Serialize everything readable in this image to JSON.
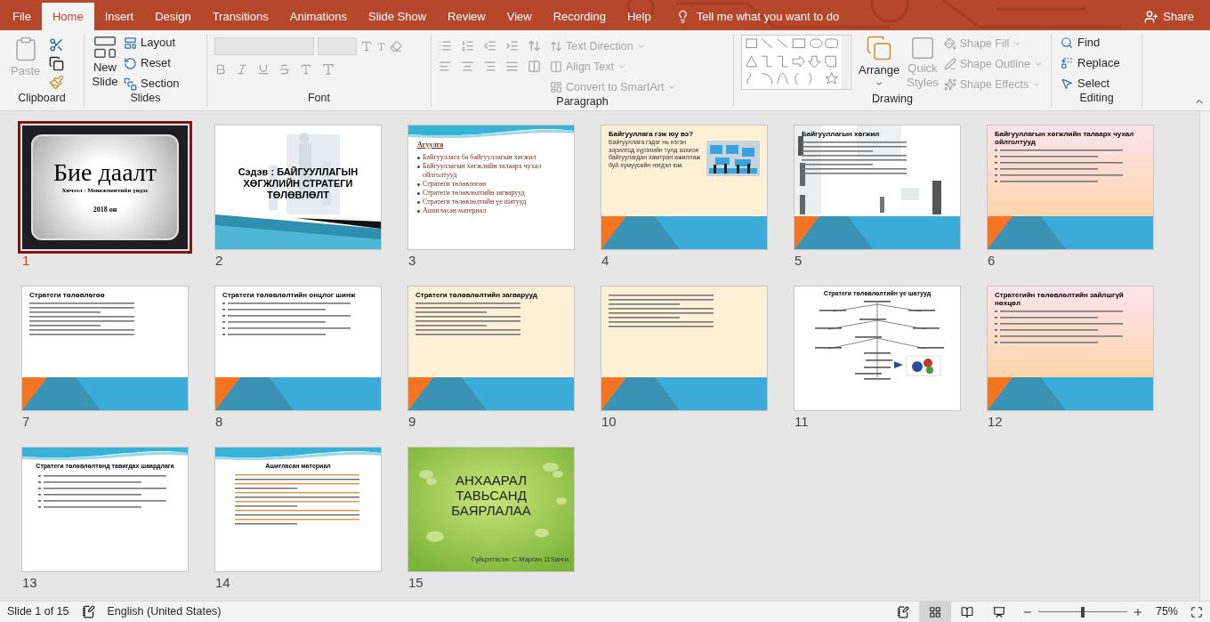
{
  "tabs": [
    {
      "label": "File",
      "selected": false
    },
    {
      "label": "Home",
      "selected": true
    },
    {
      "label": "Insert",
      "selected": false
    },
    {
      "label": "Design",
      "selected": false
    },
    {
      "label": "Transitions",
      "selected": false
    },
    {
      "label": "Animations",
      "selected": false
    },
    {
      "label": "Slide Show",
      "selected": false
    },
    {
      "label": "Review",
      "selected": false
    },
    {
      "label": "View",
      "selected": false
    },
    {
      "label": "Recording",
      "selected": false
    },
    {
      "label": "Help",
      "selected": false
    }
  ],
  "tell_me": "Tell me what you want to do",
  "share": "Share",
  "clipboard": {
    "label": "Clipboard",
    "paste": "Paste",
    "paste_disabled": true
  },
  "slides_group": {
    "label": "Slides",
    "new_slide": [
      "New",
      "Slide"
    ],
    "commands": [
      "Layout",
      "Reset",
      "Section"
    ]
  },
  "font": {
    "label": "Font"
  },
  "paragraph": {
    "label": "Paragraph",
    "commands": [
      {
        "label": "Text Direction",
        "disabled": true
      },
      {
        "label": "Align Text",
        "disabled": true
      },
      {
        "label": "Convert to SmartArt",
        "disabled": true
      }
    ]
  },
  "drawing": {
    "label": "Drawing",
    "arrange": "Arrange",
    "quick_styles": [
      "Quick",
      "Styles"
    ],
    "commands": [
      {
        "label": "Shape Fill",
        "disabled": true
      },
      {
        "label": "Shape Outline",
        "disabled": true
      },
      {
        "label": "Shape Effects",
        "disabled": true
      }
    ]
  },
  "editing": {
    "label": "Editing",
    "commands": [
      "Find",
      "Replace",
      "Select"
    ]
  },
  "slides": [
    {
      "number": "1",
      "selected": true,
      "kind": "ornate",
      "title": "Бие даалт",
      "subtitle": "Хичээл : Менежментийн үндэс",
      "footer": "2018 он"
    },
    {
      "number": "2",
      "selected": false,
      "title": "Сэдэв :  БАЙГУУЛЛАГЫН ХӨГЖЛИЙН СТРАТЕГИ ТӨЛӨВЛӨЛТ"
    },
    {
      "number": "3",
      "selected": false,
      "kind": "wave",
      "title": "Агуулга",
      "bullets": [
        "Байгууллага ба байгууллагын хөгжил",
        "Байгууллагын хөгжлийн талаарх чухал ойлголтууд",
        "Стратеги төлөвлөгөө",
        "Стратеги төлөвлөлтийн загварууд",
        "Стратеги төлөвлөлтийн үе шатууд",
        "Ашигласан материал"
      ]
    },
    {
      "number": "4",
      "selected": false,
      "kind": "cream",
      "title": "Байгууллага гэж юу вэ?",
      "body": "Байгууллага гэдэг нь нэгэн зорилгод хүрэхийн тулд зохион байгуулагдан хамтран ажиллаж буй хүмүүсийн нэгдэл юм."
    },
    {
      "number": "5",
      "selected": false,
      "kind": "white",
      "title": "Байгууллагын хөгжил",
      "parts": [
        {
          "kind": "paragraph"
        },
        {
          "kind": "backdrop"
        }
      ]
    },
    {
      "number": "6",
      "selected": false,
      "kind": "peach",
      "title": "Байгууллагын хөгжлийн талаарх чухал ойлголтууд",
      "parts": [
        {
          "kind": "list"
        }
      ]
    },
    {
      "number": "7",
      "selected": false,
      "kind": "white",
      "title": "Стратеги төлөвлөгөө",
      "parts": [
        {
          "kind": "paragraph"
        }
      ]
    },
    {
      "number": "8",
      "selected": false,
      "kind": "white",
      "title": "Стратеги төлөвлөлтийн онцлог шинж",
      "parts": [
        {
          "kind": "list"
        }
      ]
    },
    {
      "number": "9",
      "selected": false,
      "kind": "cream",
      "title": "Стратеги төлөвлөлтийн загварууд",
      "parts": [
        {
          "kind": "paragraph"
        }
      ]
    },
    {
      "number": "10",
      "selected": false,
      "kind": "cream",
      "parts": [
        {
          "kind": "paragraph"
        }
      ]
    },
    {
      "number": "11",
      "selected": false,
      "kind": "plain",
      "title": "Стратеги төлөвлөлтийн үе шатууд",
      "parts": [
        {
          "kind": "diagram"
        }
      ]
    },
    {
      "number": "12",
      "selected": false,
      "kind": "peach",
      "title": "Стратегийн төлөвлөлтийн зайлшгүй нөхцөл",
      "parts": [
        {
          "kind": "list"
        }
      ]
    },
    {
      "number": "13",
      "selected": false,
      "kind": "wave",
      "title": "Стратеги төлөвлөлтөнд тавигдах шаардлага",
      "parts": [
        {
          "kind": "list"
        }
      ]
    },
    {
      "number": "14",
      "selected": false,
      "kind": "wave",
      "title": "Ашигласан материал",
      "parts": [
        {
          "kind": "links"
        }
      ]
    },
    {
      "number": "15",
      "selected": false,
      "kind": "green",
      "title": "АНХААРАЛ ТАВЬСАНД БАЯРЛАЛАА",
      "footer": "Гүйцэтгэсэн: С.Марган  11Sанги"
    }
  ],
  "status": {
    "slide": "Slide 1 of 15",
    "language": "English (United States)",
    "zoom": "75%",
    "level": 0.5
  },
  "views": [
    {
      "kind": "normal",
      "selected": false
    },
    {
      "kind": "sorter",
      "selected": true
    },
    {
      "kind": "reading",
      "selected": false
    },
    {
      "kind": "show",
      "selected": false
    }
  ]
}
